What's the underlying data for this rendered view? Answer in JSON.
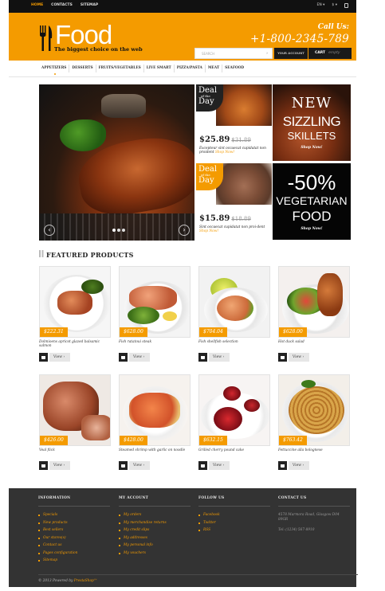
{
  "topbar": {
    "nav": [
      "HOME",
      "CONTACTS",
      "SITEMAP"
    ],
    "lang": "EN",
    "currency": "$"
  },
  "header": {
    "logo": "Food",
    "tagline": "The biggest choice on the web",
    "call_label": "Call Us:",
    "phone": "+1-800-2345-789",
    "search_placeholder": "SEARCH",
    "account_label": "YOUR ACCOUNT",
    "cart_label": "CART",
    "cart_status": "empty",
    "accent": "#f49b00"
  },
  "categories": [
    "APPETIZERS",
    "DESSERTS",
    "FRUITS/VEGETABLES",
    "LIVE SMART",
    "PIZZA/PASTA",
    "MEAT",
    "SEAFOOD"
  ],
  "deals": [
    {
      "badge_top": "Deal",
      "badge_mid": "of the",
      "badge_bottom": "Day",
      "price": "$25.89",
      "old_price": "$31.89",
      "desc": "Excepteur sint occaecat cupidatat non proident",
      "link": "Shop Now!"
    },
    {
      "badge_top": "Deal",
      "badge_mid": "of the",
      "badge_bottom": "Day",
      "price": "$15.89",
      "old_price": "$18.89",
      "desc": "Sint occaecat cupidatat non proi-dent",
      "link": "Shop Now!"
    }
  ],
  "promos": [
    {
      "line1": "NEW",
      "line2": "SIZZLING",
      "line3": "SKILLETS",
      "cta": "Shop Now!"
    },
    {
      "line1": "-50%",
      "line2": "VEGETARIAN",
      "line3": "FOOD",
      "cta": "Shop Now!"
    }
  ],
  "featured_title": "FEATURED PRODUCTS",
  "view_label": "View",
  "products": [
    {
      "price": "$222.31",
      "name": "Dolmioens apricot glazed balsamic salmon"
    },
    {
      "price": "$628.00",
      "name": "Fish ratatoui steak"
    },
    {
      "price": "$704.04",
      "name": "Fish shellfish selection"
    },
    {
      "price": "$628.00",
      "name": "Hot duck salad"
    },
    {
      "price": "$426.00",
      "name": "Veal flick"
    },
    {
      "price": "$428.00",
      "name": "Steamed shrimp with garlic on noodle"
    },
    {
      "price": "$632.15",
      "name": "Grilled cherry pound cake"
    },
    {
      "price": "$763.42",
      "name": "Fettuccine alla bolognese"
    }
  ],
  "footer": {
    "information": {
      "title": "INFORMATION",
      "items": [
        "Specials",
        "New products",
        "Best sellers",
        "Our stores(s)",
        "Contact us",
        "Pages configuration",
        "Sitemap"
      ]
    },
    "account": {
      "title": "MY ACCOUNT",
      "items": [
        "My orders",
        "My merchandise returns",
        "My credit slips",
        "My addresses",
        "My personal info",
        "My vouchers"
      ]
    },
    "follow": {
      "title": "FOLLOW US",
      "items": [
        "Facebook",
        "Twitter",
        "RSS"
      ]
    },
    "contact": {
      "title": "CONTACT US",
      "address": "4578 Marmora Road, Glasgow D04 89GR",
      "tel": "Tel: (1234) 567-8910"
    },
    "copyright_pre": "© 2013 Powered by",
    "copyright_brand": "PrestaShop™"
  }
}
